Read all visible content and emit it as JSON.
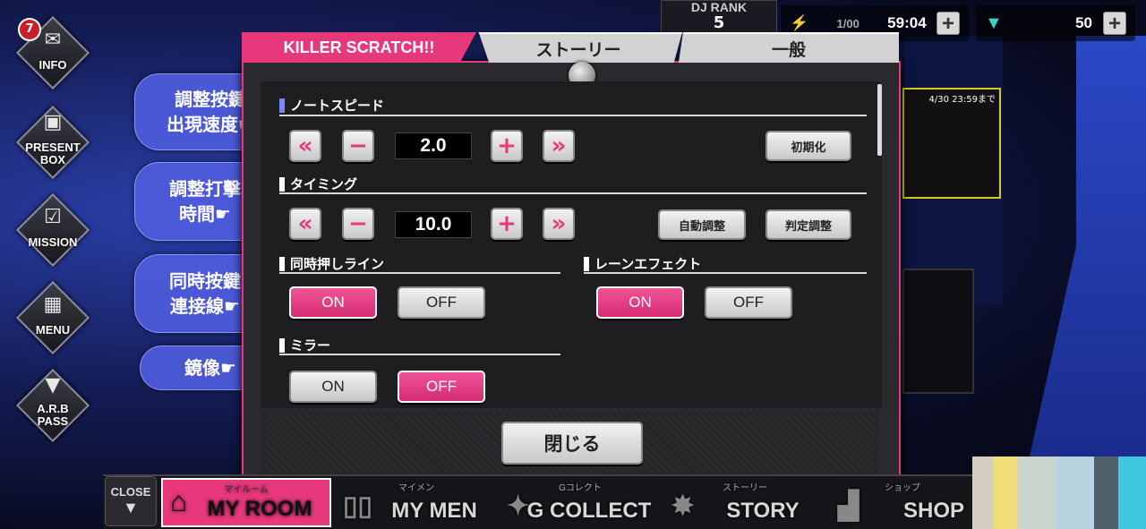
{
  "sidebar": {
    "info": {
      "label": "INFO",
      "badge": "7",
      "icon": "mail-icon"
    },
    "present": {
      "label": "PRESENT\nBOX",
      "icon": "gift-icon"
    },
    "mission": {
      "label": "MISSION",
      "icon": "check-icon"
    },
    "menu": {
      "label": "MENU",
      "icon": "grid-icon"
    },
    "arb": {
      "label": "A.R.B\nPASS",
      "icon": "ticket-icon"
    }
  },
  "annotations": [
    "調整按鍵\n出現速度☛",
    "調整打擊\n時間☛",
    "同時按鍵\n連接線☛",
    "鏡像☛"
  ],
  "header": {
    "rank_label": "DJ RANK",
    "rank_value": "5",
    "stamina": "1/00",
    "timer": "59:04",
    "gems": "50"
  },
  "tabs": [
    "KILLER SCRATCH!!",
    "ストーリー",
    "一般"
  ],
  "settings": {
    "note_speed": {
      "title": "ノートスピード",
      "value": "2.0",
      "reset_label": "初期化"
    },
    "timing": {
      "title": "タイミング",
      "value": "10.0",
      "auto_label": "自動調整",
      "judge_label": "判定調整"
    },
    "simultaneous_line": {
      "title": "同時押しライン",
      "on": "ON",
      "off": "OFF",
      "selected": "ON"
    },
    "lane_effect": {
      "title": "レーンエフェクト",
      "on": "ON",
      "off": "OFF",
      "selected": "ON"
    },
    "mirror": {
      "title": "ミラー",
      "on": "ON",
      "off": "OFF",
      "selected": "OFF"
    }
  },
  "close_label": "閉じる",
  "promo": {
    "date": "4/30 23:59まで"
  },
  "bottom_nav": {
    "close": "CLOSE",
    "items": [
      {
        "label": "MY ROOM",
        "sub": "マイルーム"
      },
      {
        "label": "MY MEN",
        "sub": "マイメン"
      },
      {
        "label": "G COLLECT",
        "sub": "Gコレクト"
      },
      {
        "label": "STORY",
        "sub": "ストーリー"
      },
      {
        "label": "SHOP",
        "sub": "ショップ"
      }
    ]
  },
  "colors": {
    "accent": "#e8387c",
    "bubble": "#4e5cdc"
  }
}
